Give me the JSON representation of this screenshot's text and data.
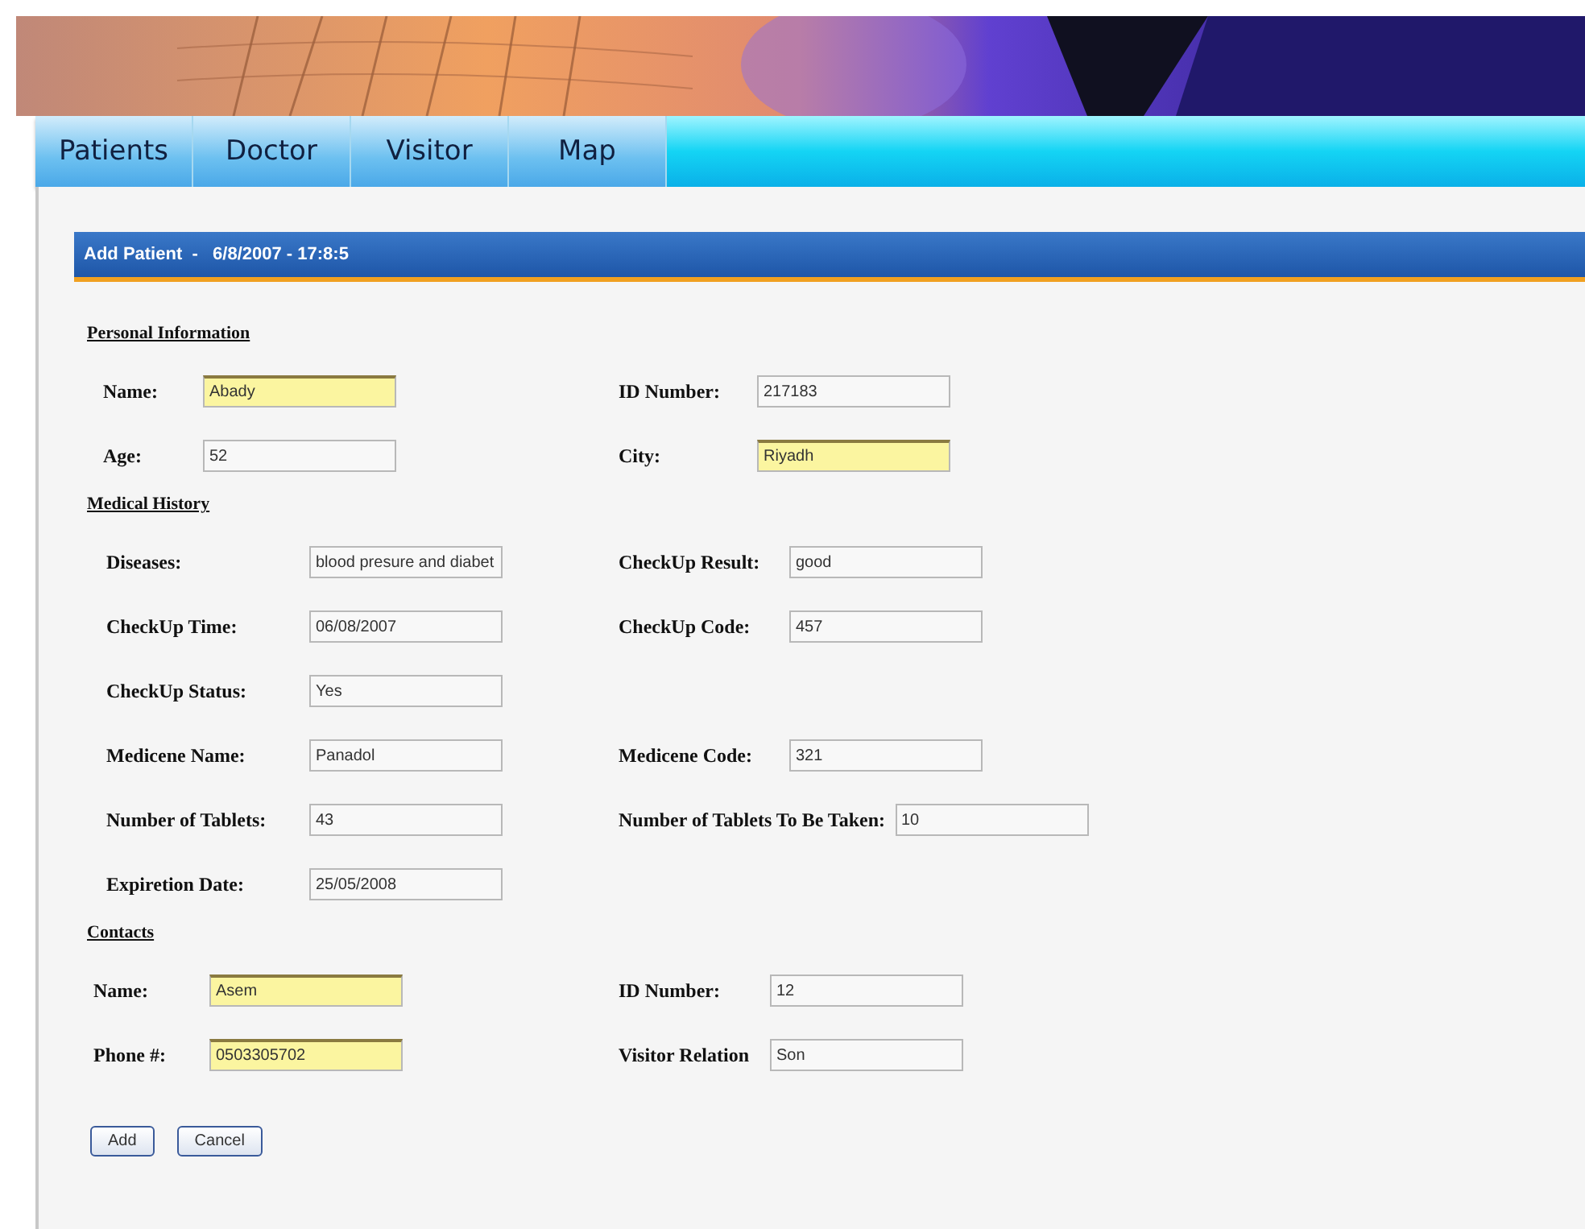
{
  "tabs": [
    {
      "label": "Patients"
    },
    {
      "label": "Doctor"
    },
    {
      "label": "Visitor"
    },
    {
      "label": "Map"
    }
  ],
  "panel": {
    "title": "Add Patient  -   6/8/2007 - 17:8:5"
  },
  "sections": [
    {
      "title": "Personal Information",
      "rows": [
        {
          "left": {
            "label": "Name:",
            "value": "Abady",
            "highlighted": true
          },
          "right": {
            "label": "ID Number:",
            "value": "217183",
            "highlighted": false
          }
        },
        {
          "left": {
            "label": "Age:",
            "value": "52",
            "highlighted": false
          },
          "right": {
            "label": "City:",
            "value": "Riyadh",
            "highlighted": true
          }
        }
      ]
    },
    {
      "title": "Medical History",
      "rows": [
        {
          "left": {
            "label": "Diseases:",
            "value": "blood presure and diabet",
            "highlighted": false
          },
          "right": {
            "label": "CheckUp Result:",
            "value": "good",
            "highlighted": false
          }
        },
        {
          "left": {
            "label": "CheckUp Time:",
            "value": "06/08/2007",
            "highlighted": false
          },
          "right": {
            "label": "CheckUp Code:",
            "value": "457",
            "highlighted": false
          }
        },
        {
          "left": {
            "label": "CheckUp Status:",
            "value": "Yes",
            "highlighted": false
          }
        },
        {
          "left": {
            "label": "Medicene Name:",
            "value": "Panadol",
            "highlighted": false
          },
          "right": {
            "label": "Medicene Code:",
            "value": "321",
            "highlighted": false
          }
        },
        {
          "left": {
            "label": "Number of Tablets:",
            "value": "43",
            "highlighted": false
          },
          "right": {
            "label": "Number of Tablets To Be Taken:",
            "value": "10",
            "highlighted": false
          }
        },
        {
          "left": {
            "label": "Expiretion Date:",
            "value": "25/05/2008",
            "highlighted": false
          }
        }
      ]
    },
    {
      "title": "Contacts",
      "rows": [
        {
          "left": {
            "label": "Name:",
            "value": "Asem",
            "highlighted": true
          },
          "right": {
            "label": "ID Number:",
            "value": "12",
            "highlighted": false
          }
        },
        {
          "left": {
            "label": "Phone #:",
            "value": "0503305702",
            "highlighted": true
          },
          "right": {
            "label": "Visitor Relation",
            "value": "Son",
            "highlighted": false
          }
        }
      ]
    }
  ],
  "buttons": [
    "Add",
    "Cancel"
  ]
}
